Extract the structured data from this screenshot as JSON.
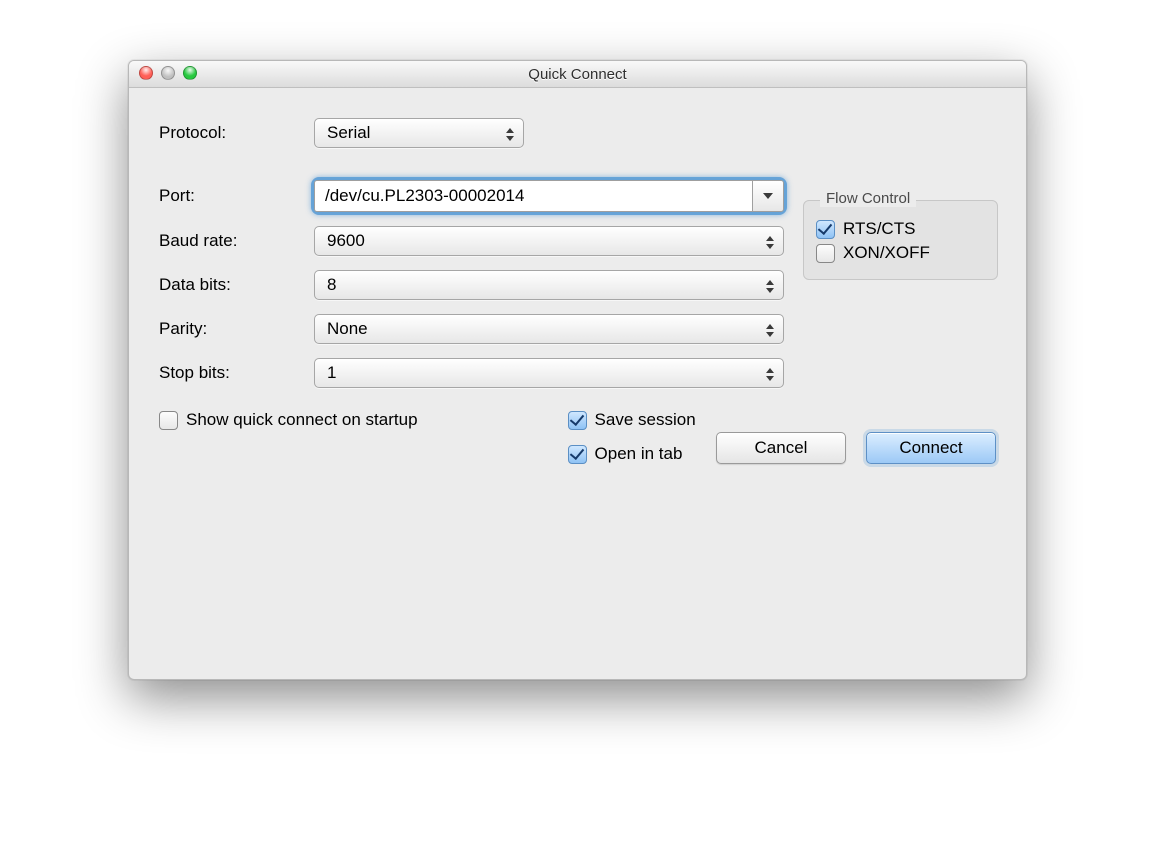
{
  "title": "Quick Connect",
  "labels": {
    "protocol": "Protocol:",
    "port": "Port:",
    "baud": "Baud rate:",
    "databits": "Data bits:",
    "parity": "Parity:",
    "stopbits": "Stop bits:"
  },
  "values": {
    "protocol": "Serial",
    "port": "/dev/cu.PL2303-00002014",
    "baud": "9600",
    "databits": "8",
    "parity": "None",
    "stopbits": "1"
  },
  "flow_control": {
    "title": "Flow Control",
    "rts_cts_label": "RTS/CTS",
    "rts_cts_checked": true,
    "xon_xoff_label": "XON/XOFF",
    "xon_xoff_checked": false
  },
  "options": {
    "show_on_startup_label": "Show quick connect on startup",
    "show_on_startup_checked": false,
    "save_session_label": "Save session",
    "save_session_checked": true,
    "open_in_tab_label": "Open in tab",
    "open_in_tab_checked": true
  },
  "buttons": {
    "cancel": "Cancel",
    "connect": "Connect"
  }
}
